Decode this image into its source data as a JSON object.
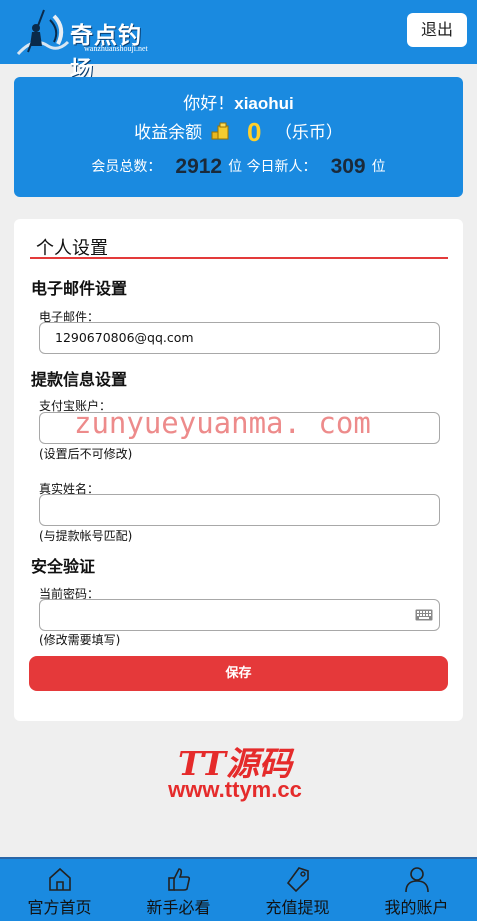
{
  "header": {
    "logo_title": "奇点钓场",
    "logo_subtitle": "wanzhuanshouji.net",
    "logout_label": "退出"
  },
  "info": {
    "greeting_prefix": "你好！",
    "username": "xiaohui",
    "balance_label": "收益余额",
    "balance_value": "0",
    "balance_unit": "（乐币）",
    "members_label": "会员总数：",
    "members_count": "2912",
    "members_unit": "位",
    "new_today_label": "今日新人：",
    "new_today_count": "309",
    "new_today_unit": "位"
  },
  "settings": {
    "title": "个人设置",
    "email_section": {
      "heading": "电子邮件设置",
      "email_label": "电子邮件：",
      "email_value": "1290670806@qq.com"
    },
    "withdraw_section": {
      "heading": "提款信息设置",
      "alipay_label": "支付宝账户：",
      "alipay_value": "",
      "alipay_hint": "(设置后不可修改)",
      "realname_label": "真实姓名：",
      "realname_value": "",
      "realname_hint": "(与提款帐号匹配)"
    },
    "security_section": {
      "heading": "安全验证",
      "password_label": "当前密码：",
      "password_value": "",
      "password_hint": "(修改需要填写)"
    },
    "save_label": "保存"
  },
  "watermark_text": "zunyueyuanma. com",
  "tt_logo": {
    "main": "TT源码",
    "url": "www.ttym.cc"
  },
  "bottom_nav": {
    "items": [
      {
        "label": "官方首页",
        "icon": "home-icon"
      },
      {
        "label": "新手必看",
        "icon": "thumbs-up-icon"
      },
      {
        "label": "充值提现",
        "icon": "tag-icon"
      },
      {
        "label": "我的账户",
        "icon": "user-icon"
      }
    ]
  },
  "colors": {
    "primary_blue": "#1a8ae0",
    "accent_red": "#e5393a",
    "balance_yellow": "#ffcf2a"
  }
}
